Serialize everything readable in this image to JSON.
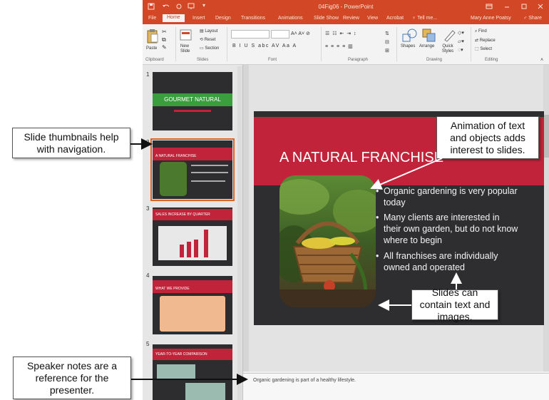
{
  "window": {
    "title": "04Fig06 - PowerPoint",
    "quick_access": [
      "save-icon",
      "undo-icon",
      "redo-icon",
      "present-icon"
    ],
    "controls": [
      "ribbon-display-icon",
      "minimize-icon",
      "restore-icon",
      "close-icon"
    ]
  },
  "ribbon_tabs": [
    "File",
    "Home",
    "Insert",
    "Design",
    "Transitions",
    "Animations",
    "Slide Show",
    "Review",
    "View",
    "Acrobat",
    "Tell me..."
  ],
  "active_tab": "Home",
  "user": {
    "name": "Mary Anne Poatsy",
    "share": "Share"
  },
  "ribbon": {
    "clipboard": {
      "paste": "Paste",
      "label": "Clipboard"
    },
    "slides": {
      "new_slide": "New Slide",
      "layout": "Layout",
      "reset": "Reset",
      "section": "Section",
      "label": "Slides"
    },
    "font": {
      "label": "Font",
      "buttons": "B I U S abc AV Aa A"
    },
    "paragraph": {
      "label": "Paragraph"
    },
    "drawing": {
      "shapes": "Shapes",
      "arrange": "Arrange",
      "quick_styles": "Quick Styles",
      "label": "Drawing"
    },
    "editing": {
      "find": "Find",
      "replace": "Replace",
      "select": "Select",
      "label": "Editing"
    }
  },
  "thumbnails": [
    {
      "number": "1",
      "title": "GOURMET NATURAL"
    },
    {
      "number": "2",
      "title": "A NATURAL FRANCHISE"
    },
    {
      "number": "3",
      "title": "SALES INCREASE BY QUARTER"
    },
    {
      "number": "4",
      "title": "WHAT WE PROVIDE"
    },
    {
      "number": "5",
      "title": "YEAR-TO-YEAR COMPARISON"
    }
  ],
  "slide": {
    "title": "A NATURAL FRANCHISE",
    "bullets": [
      "Organic gardening is very popular today",
      "Many clients are interested in their own garden, but do not know where to begin",
      "All franchises are individually owned and operated"
    ]
  },
  "notes": "Organic gardening is part of a healthy lifestyle.",
  "callouts": {
    "thumbnails": "Slide thumbnails help with navigation.",
    "animation": "Animation of text and objects adds interest to slides.",
    "content": "Slides can contain text and images.",
    "notes": "Speaker notes are a reference for the presenter."
  },
  "colors": {
    "accent": "#d24726",
    "slide_red": "#c1243a",
    "slide_dark": "#2e2e30",
    "selection": "#e1621e"
  }
}
